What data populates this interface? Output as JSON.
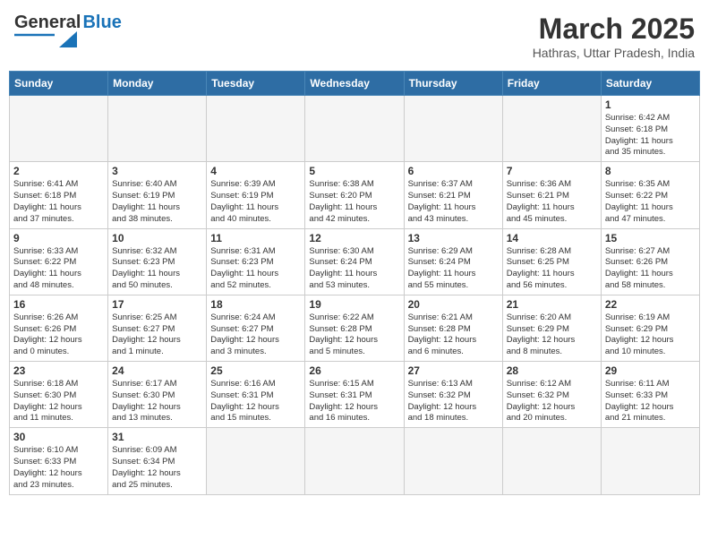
{
  "header": {
    "logo_general": "General",
    "logo_blue": "Blue",
    "month_title": "March 2025",
    "subtitle": "Hathras, Uttar Pradesh, India"
  },
  "weekdays": [
    "Sunday",
    "Monday",
    "Tuesday",
    "Wednesday",
    "Thursday",
    "Friday",
    "Saturday"
  ],
  "weeks": [
    [
      {
        "day": "",
        "info": ""
      },
      {
        "day": "",
        "info": ""
      },
      {
        "day": "",
        "info": ""
      },
      {
        "day": "",
        "info": ""
      },
      {
        "day": "",
        "info": ""
      },
      {
        "day": "",
        "info": ""
      },
      {
        "day": "1",
        "info": "Sunrise: 6:42 AM\nSunset: 6:18 PM\nDaylight: 11 hours\nand 35 minutes."
      }
    ],
    [
      {
        "day": "2",
        "info": "Sunrise: 6:41 AM\nSunset: 6:18 PM\nDaylight: 11 hours\nand 37 minutes."
      },
      {
        "day": "3",
        "info": "Sunrise: 6:40 AM\nSunset: 6:19 PM\nDaylight: 11 hours\nand 38 minutes."
      },
      {
        "day": "4",
        "info": "Sunrise: 6:39 AM\nSunset: 6:19 PM\nDaylight: 11 hours\nand 40 minutes."
      },
      {
        "day": "5",
        "info": "Sunrise: 6:38 AM\nSunset: 6:20 PM\nDaylight: 11 hours\nand 42 minutes."
      },
      {
        "day": "6",
        "info": "Sunrise: 6:37 AM\nSunset: 6:21 PM\nDaylight: 11 hours\nand 43 minutes."
      },
      {
        "day": "7",
        "info": "Sunrise: 6:36 AM\nSunset: 6:21 PM\nDaylight: 11 hours\nand 45 minutes."
      },
      {
        "day": "8",
        "info": "Sunrise: 6:35 AM\nSunset: 6:22 PM\nDaylight: 11 hours\nand 47 minutes."
      }
    ],
    [
      {
        "day": "9",
        "info": "Sunrise: 6:33 AM\nSunset: 6:22 PM\nDaylight: 11 hours\nand 48 minutes."
      },
      {
        "day": "10",
        "info": "Sunrise: 6:32 AM\nSunset: 6:23 PM\nDaylight: 11 hours\nand 50 minutes."
      },
      {
        "day": "11",
        "info": "Sunrise: 6:31 AM\nSunset: 6:23 PM\nDaylight: 11 hours\nand 52 minutes."
      },
      {
        "day": "12",
        "info": "Sunrise: 6:30 AM\nSunset: 6:24 PM\nDaylight: 11 hours\nand 53 minutes."
      },
      {
        "day": "13",
        "info": "Sunrise: 6:29 AM\nSunset: 6:24 PM\nDaylight: 11 hours\nand 55 minutes."
      },
      {
        "day": "14",
        "info": "Sunrise: 6:28 AM\nSunset: 6:25 PM\nDaylight: 11 hours\nand 56 minutes."
      },
      {
        "day": "15",
        "info": "Sunrise: 6:27 AM\nSunset: 6:26 PM\nDaylight: 11 hours\nand 58 minutes."
      }
    ],
    [
      {
        "day": "16",
        "info": "Sunrise: 6:26 AM\nSunset: 6:26 PM\nDaylight: 12 hours\nand 0 minutes."
      },
      {
        "day": "17",
        "info": "Sunrise: 6:25 AM\nSunset: 6:27 PM\nDaylight: 12 hours\nand 1 minute."
      },
      {
        "day": "18",
        "info": "Sunrise: 6:24 AM\nSunset: 6:27 PM\nDaylight: 12 hours\nand 3 minutes."
      },
      {
        "day": "19",
        "info": "Sunrise: 6:22 AM\nSunset: 6:28 PM\nDaylight: 12 hours\nand 5 minutes."
      },
      {
        "day": "20",
        "info": "Sunrise: 6:21 AM\nSunset: 6:28 PM\nDaylight: 12 hours\nand 6 minutes."
      },
      {
        "day": "21",
        "info": "Sunrise: 6:20 AM\nSunset: 6:29 PM\nDaylight: 12 hours\nand 8 minutes."
      },
      {
        "day": "22",
        "info": "Sunrise: 6:19 AM\nSunset: 6:29 PM\nDaylight: 12 hours\nand 10 minutes."
      }
    ],
    [
      {
        "day": "23",
        "info": "Sunrise: 6:18 AM\nSunset: 6:30 PM\nDaylight: 12 hours\nand 11 minutes."
      },
      {
        "day": "24",
        "info": "Sunrise: 6:17 AM\nSunset: 6:30 PM\nDaylight: 12 hours\nand 13 minutes."
      },
      {
        "day": "25",
        "info": "Sunrise: 6:16 AM\nSunset: 6:31 PM\nDaylight: 12 hours\nand 15 minutes."
      },
      {
        "day": "26",
        "info": "Sunrise: 6:15 AM\nSunset: 6:31 PM\nDaylight: 12 hours\nand 16 minutes."
      },
      {
        "day": "27",
        "info": "Sunrise: 6:13 AM\nSunset: 6:32 PM\nDaylight: 12 hours\nand 18 minutes."
      },
      {
        "day": "28",
        "info": "Sunrise: 6:12 AM\nSunset: 6:32 PM\nDaylight: 12 hours\nand 20 minutes."
      },
      {
        "day": "29",
        "info": "Sunrise: 6:11 AM\nSunset: 6:33 PM\nDaylight: 12 hours\nand 21 minutes."
      }
    ],
    [
      {
        "day": "30",
        "info": "Sunrise: 6:10 AM\nSunset: 6:33 PM\nDaylight: 12 hours\nand 23 minutes."
      },
      {
        "day": "31",
        "info": "Sunrise: 6:09 AM\nSunset: 6:34 PM\nDaylight: 12 hours\nand 25 minutes."
      },
      {
        "day": "",
        "info": ""
      },
      {
        "day": "",
        "info": ""
      },
      {
        "day": "",
        "info": ""
      },
      {
        "day": "",
        "info": ""
      },
      {
        "day": "",
        "info": ""
      }
    ]
  ]
}
